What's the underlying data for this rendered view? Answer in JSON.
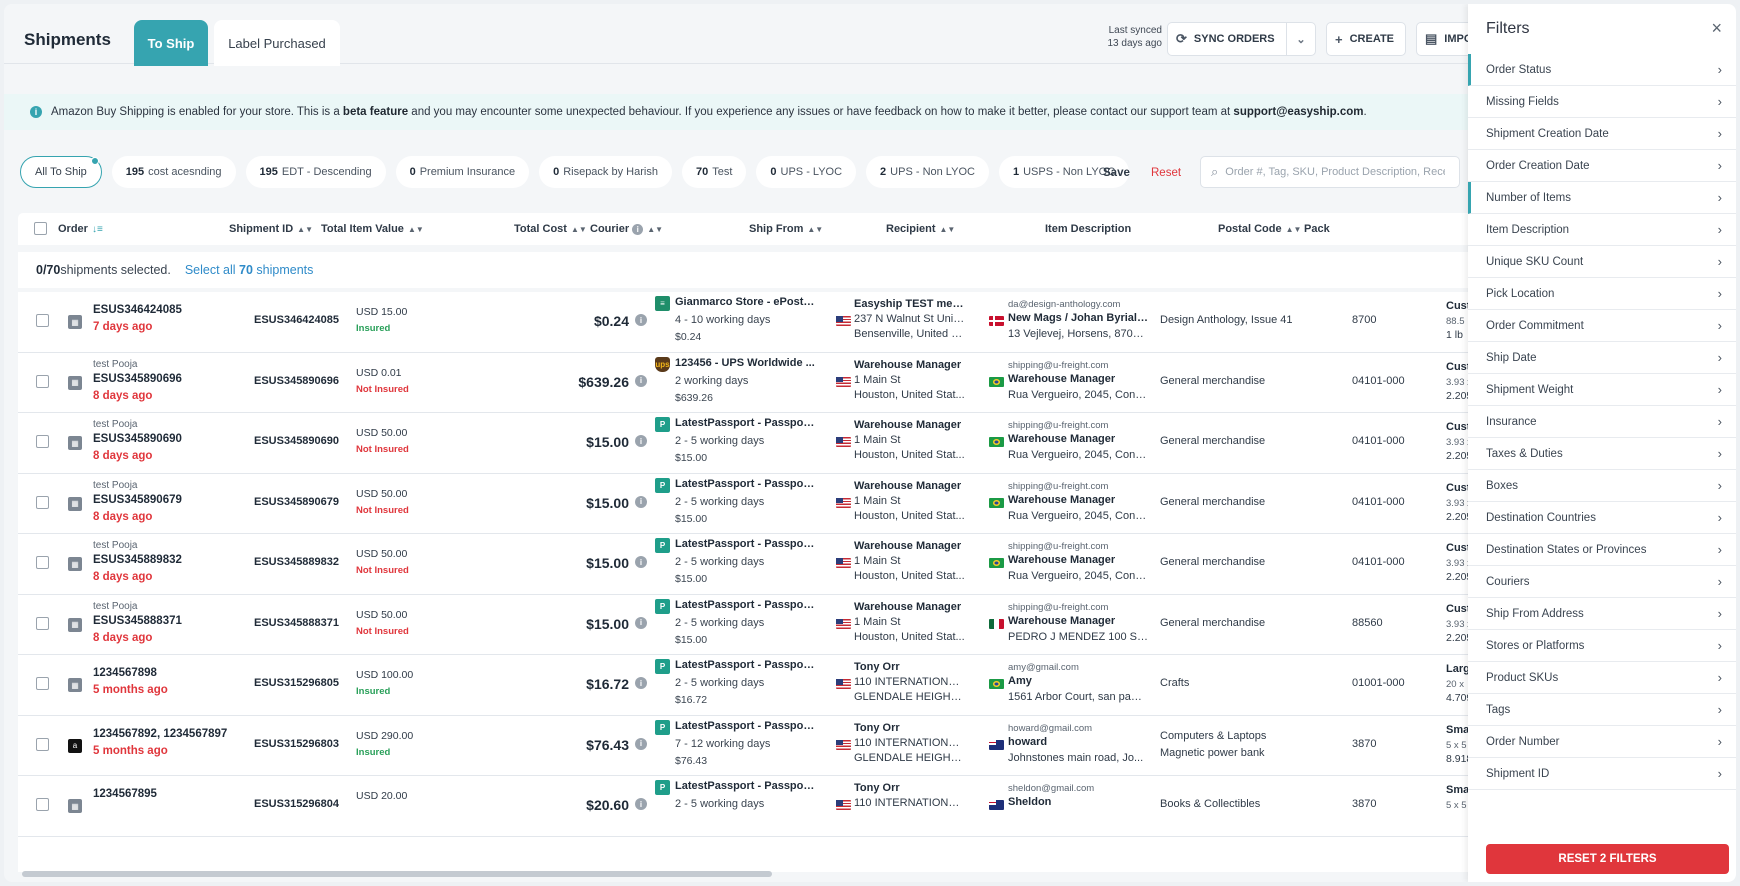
{
  "header": {
    "title": "Shipments",
    "tabs": [
      {
        "label": "To Ship",
        "active": true
      },
      {
        "label": "Label Purchased",
        "active": false
      }
    ],
    "last_synced_line1": "Last synced",
    "last_synced_line2": "13 days ago",
    "sync_label": "SYNC ORDERS",
    "create_label": "CREATE",
    "import_label": "IMPO"
  },
  "banner": {
    "text_pre": "Amazon Buy Shipping is enabled for your store. This is a ",
    "text_bold": "beta feature",
    "text_mid": " and you may encounter some unexpected behaviour. If you experience any issues or have feedback on how to make it better, please contact our support team at ",
    "email": "support@easyship.com",
    "text_end": "."
  },
  "chips": [
    {
      "count": "",
      "label": "All To Ship",
      "active": true
    },
    {
      "count": "195",
      "label": "cost acesnding",
      "active": false
    },
    {
      "count": "195",
      "label": "EDT - Descending",
      "active": false
    },
    {
      "count": "0",
      "label": "Premium Insurance",
      "active": false
    },
    {
      "count": "0",
      "label": "Risepack by Harish",
      "active": false
    },
    {
      "count": "70",
      "label": "Test",
      "active": false
    },
    {
      "count": "0",
      "label": "UPS - LYOC",
      "active": false
    },
    {
      "count": "2",
      "label": "UPS - Non LYOC",
      "active": false
    },
    {
      "count": "1",
      "label": "USPS - Non LYOC",
      "active": false
    }
  ],
  "save_label": "Save",
  "reset_label": "Reset",
  "search_placeholder": "Order #, Tag, SKU, Product Description, Receiver",
  "columns": {
    "order": "Order",
    "shipment_id": "Shipment ID",
    "total_item_value": "Total Item Value",
    "total_cost": "Total Cost",
    "courier": "Courier",
    "ship_from": "Ship From",
    "recipient": "Recipient",
    "item_description": "Item Description",
    "postal_code": "Postal Code",
    "pack": "Pack"
  },
  "selection": {
    "count": "0/70",
    "text": " shipments selected.",
    "select_all_pre": "Select all ",
    "select_all_count": "70",
    "select_all_post": " shipments"
  },
  "rows": [
    {
      "tag": "",
      "order": "ESUS346424085",
      "age": "7 days ago",
      "store": "store",
      "shipment_id": "ESUS346424085",
      "value": "USD 15.00",
      "insurance": "Insured",
      "insured": true,
      "cost": "$0.24",
      "courier_logo": "gm",
      "courier": "Gianmarco Store - ePost ...",
      "days": "4 - 10 working days",
      "courier_price": "$0.24",
      "from_name": "Easyship TEST merc...",
      "from_flag": "us",
      "from_addr": "237 N Walnut St Unit E",
      "from_city": "Bensenville, United S...",
      "email": "da@design-anthology.com",
      "to_flag": "dk",
      "to_name": "New Mags / Johan Byrial ...",
      "to_addr": "13 Vejlevej, Horsens, 8700, ...",
      "desc": [
        "Design Anthology, Issue 41"
      ],
      "postal": "8700",
      "pack_name": "Cust",
      "pack_dim": "88.5",
      "pack_wt": "1 lb"
    },
    {
      "tag": "test Pooja",
      "order": "ESUS345890696",
      "age": "8 days ago",
      "store": "store",
      "shipment_id": "ESUS345890696",
      "value": "USD 0.01",
      "insurance": "Not Insured",
      "insured": false,
      "cost": "$639.26",
      "courier_logo": "ups",
      "courier": "123456 - UPS Worldwide ...",
      "days": "2 working days",
      "courier_price": "$639.26",
      "from_name": "Warehouse Manager",
      "from_flag": "us",
      "from_addr": "1 Main St",
      "from_city": "Houston, United Stat...",
      "email": "shipping@u-freight.com",
      "to_flag": "br",
      "to_name": "Warehouse Manager",
      "to_addr": "Rua Vergueiro, 2045, Conj. ...",
      "desc": [
        "General merchandise"
      ],
      "postal": "04101-000",
      "pack_name": "Cust",
      "pack_dim": "3.93 x",
      "pack_wt": "2.205"
    },
    {
      "tag": "test Pooja",
      "order": "ESUS345890690",
      "age": "8 days ago",
      "store": "store",
      "shipment_id": "ESUS345890690",
      "value": "USD 50.00",
      "insurance": "Not Insured",
      "insured": false,
      "cost": "$15.00",
      "courier_logo": "pp",
      "courier": "LatestPassport - Passpor...",
      "days": "2 - 5 working days",
      "courier_price": "$15.00",
      "from_name": "Warehouse Manager",
      "from_flag": "us",
      "from_addr": "1 Main St",
      "from_city": "Houston, United Stat...",
      "email": "shipping@u-freight.com",
      "to_flag": "br",
      "to_name": "Warehouse Manager",
      "to_addr": "Rua Vergueiro, 2045, Conj. ...",
      "desc": [
        "General merchandise"
      ],
      "postal": "04101-000",
      "pack_name": "Cust",
      "pack_dim": "3.93 x",
      "pack_wt": "2.205"
    },
    {
      "tag": "test Pooja",
      "order": "ESUS345890679",
      "age": "8 days ago",
      "store": "store",
      "shipment_id": "ESUS345890679",
      "value": "USD 50.00",
      "insurance": "Not Insured",
      "insured": false,
      "cost": "$15.00",
      "courier_logo": "pp",
      "courier": "LatestPassport - Passpor...",
      "days": "2 - 5 working days",
      "courier_price": "$15.00",
      "from_name": "Warehouse Manager",
      "from_flag": "us",
      "from_addr": "1 Main St",
      "from_city": "Houston, United Stat...",
      "email": "shipping@u-freight.com",
      "to_flag": "br",
      "to_name": "Warehouse Manager",
      "to_addr": "Rua Vergueiro, 2045, Conj. ...",
      "desc": [
        "General merchandise"
      ],
      "postal": "04101-000",
      "pack_name": "Cust",
      "pack_dim": "3.93 x",
      "pack_wt": "2.205"
    },
    {
      "tag": "test Pooja",
      "order": "ESUS345889832",
      "age": "8 days ago",
      "store": "store",
      "shipment_id": "ESUS345889832",
      "value": "USD 50.00",
      "insurance": "Not Insured",
      "insured": false,
      "cost": "$15.00",
      "courier_logo": "pp",
      "courier": "LatestPassport - Passpor...",
      "days": "2 - 5 working days",
      "courier_price": "$15.00",
      "from_name": "Warehouse Manager",
      "from_flag": "us",
      "from_addr": "1 Main St",
      "from_city": "Houston, United Stat...",
      "email": "shipping@u-freight.com",
      "to_flag": "br",
      "to_name": "Warehouse Manager",
      "to_addr": "Rua Vergueiro, 2045, Conj. ...",
      "desc": [
        "General merchandise"
      ],
      "postal": "04101-000",
      "pack_name": "Cust",
      "pack_dim": "3.93 x",
      "pack_wt": "2.205"
    },
    {
      "tag": "test Pooja",
      "order": "ESUS345888371",
      "age": "8 days ago",
      "store": "store",
      "shipment_id": "ESUS345888371",
      "value": "USD 50.00",
      "insurance": "Not Insured",
      "insured": false,
      "cost": "$15.00",
      "courier_logo": "pp",
      "courier": "LatestPassport - Passpor...",
      "days": "2 - 5 working days",
      "courier_price": "$15.00",
      "from_name": "Warehouse Manager",
      "from_flag": "us",
      "from_addr": "1 Main St",
      "from_city": "Houston, United Stat...",
      "email": "shipping@u-freight.com",
      "to_flag": "mx",
      "to_name": "Warehouse Manager",
      "to_addr": "PEDRO J MENDEZ 100 S/N, ...",
      "desc": [
        "General merchandise"
      ],
      "postal": "88560",
      "pack_name": "Cust",
      "pack_dim": "3.93 x",
      "pack_wt": "2.205"
    },
    {
      "tag": "",
      "order": "1234567898",
      "age": "5 months ago",
      "store": "store",
      "shipment_id": "ESUS315296805",
      "value": "USD 100.00",
      "insurance": "Insured",
      "insured": true,
      "cost": "$16.72",
      "courier_logo": "pp",
      "courier": "LatestPassport - Passpor...",
      "days": "2 - 5 working days",
      "courier_price": "$16.72",
      "from_name": "Tony Orr",
      "from_flag": "us",
      "from_addr": "110 INTERNATIONALE B...",
      "from_city": "GLENDALE HEIGHTS, U...",
      "email": "amy@gmail.com",
      "to_flag": "br",
      "to_name": "Amy",
      "to_addr": "1561 Arbor Court, san paol...",
      "desc": [
        "Crafts"
      ],
      "postal": "01001-000",
      "pack_name": "Large",
      "pack_dim": "20 x",
      "pack_wt": "4.709"
    },
    {
      "tag": "",
      "order": "1234567892, 1234567897",
      "age": "5 months ago",
      "store": "amz",
      "shipment_id": "ESUS315296803",
      "value": "USD 290.00",
      "insurance": "Insured",
      "insured": true,
      "cost": "$76.43",
      "courier_logo": "pp",
      "courier": "LatestPassport - Passpor...",
      "days": "7 - 12 working days",
      "courier_price": "$76.43",
      "from_name": "Tony Orr",
      "from_flag": "us",
      "from_addr": "110 INTERNATIONALE B...",
      "from_city": "GLENDALE HEIGHTS, U...",
      "email": "howard@gmail.com",
      "to_flag": "au",
      "to_name": "howard",
      "to_addr": "Johnstones main road, Jo...",
      "desc": [
        "Computers & Laptops",
        "Magnetic power bank"
      ],
      "postal": "3870",
      "pack_name": "Sma",
      "pack_dim": "5 x 5",
      "pack_wt": "8.918"
    },
    {
      "tag": "",
      "order": "1234567895",
      "age": "",
      "store": "store",
      "shipment_id": "ESUS315296804",
      "value": "USD 20.00",
      "insurance": "",
      "insured": true,
      "cost": "$20.60",
      "courier_logo": "pp",
      "courier": "LatestPassport - Passpor...",
      "days": "2 - 5 working days",
      "courier_price": "",
      "from_name": "Tony Orr",
      "from_flag": "us",
      "from_addr": "110 INTERNATIONALE B...",
      "from_city": "",
      "email": "sheldon@gmail.com",
      "to_flag": "au",
      "to_name": "Sheldon",
      "to_addr": "",
      "desc": [
        "Books & Collectibles"
      ],
      "postal": "3870",
      "pack_name": "Sma",
      "pack_dim": "5 x 5",
      "pack_wt": ""
    }
  ],
  "filters_panel": {
    "title": "Filters",
    "items": [
      {
        "label": "Order Status",
        "active": true
      },
      {
        "label": "Missing Fields",
        "active": false
      },
      {
        "label": "Shipment Creation Date",
        "active": false
      },
      {
        "label": "Order Creation Date",
        "active": false
      },
      {
        "label": "Number of Items",
        "active": true
      },
      {
        "label": "Item Description",
        "active": false
      },
      {
        "label": "Unique SKU Count",
        "active": false
      },
      {
        "label": "Pick Location",
        "active": false
      },
      {
        "label": "Order Commitment",
        "active": false
      },
      {
        "label": "Ship Date",
        "active": false
      },
      {
        "label": "Shipment Weight",
        "active": false
      },
      {
        "label": "Insurance",
        "active": false
      },
      {
        "label": "Taxes & Duties",
        "active": false
      },
      {
        "label": "Boxes",
        "active": false
      },
      {
        "label": "Destination Countries",
        "active": false
      },
      {
        "label": "Destination States or Provinces",
        "active": false
      },
      {
        "label": "Couriers",
        "active": false
      },
      {
        "label": "Ship From Address",
        "active": false
      },
      {
        "label": "Stores or Platforms",
        "active": false
      },
      {
        "label": "Product SKUs",
        "active": false
      },
      {
        "label": "Tags",
        "active": false
      },
      {
        "label": "Order Number",
        "active": false
      },
      {
        "label": "Shipment ID",
        "active": false
      }
    ],
    "reset_label": "RESET 2 FILTERS"
  }
}
